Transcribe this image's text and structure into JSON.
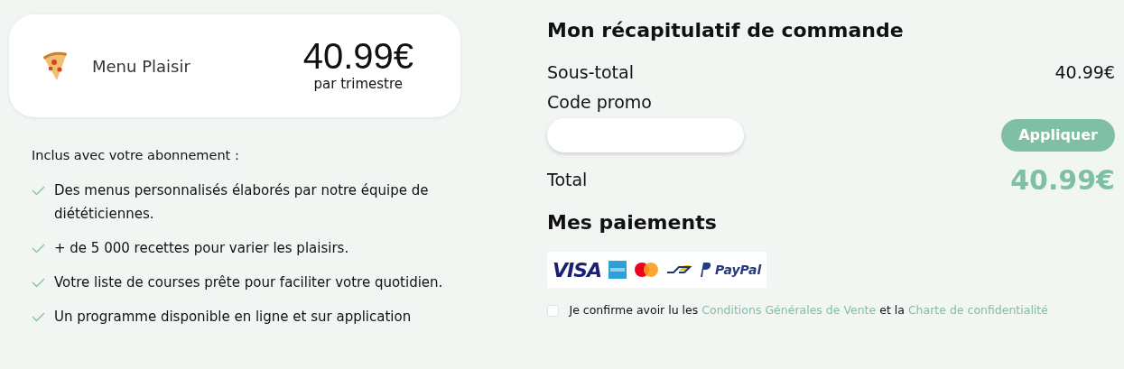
{
  "plan": {
    "name": "Menu Plaisir",
    "price": "40.99€",
    "period": "par trimestre"
  },
  "included": {
    "title": "Inclus avec votre abonnement :",
    "items": [
      {
        "text": "Des menus personnalisés élaborés par notre équipe de diététiciennes."
      },
      {
        "text": "+ de 5 000 recettes pour varier les plaisirs."
      },
      {
        "text": "Votre liste de courses prête pour faciliter votre quotidien."
      },
      {
        "text": "Un programme disponible en ligne et sur application"
      }
    ]
  },
  "summary": {
    "title": "Mon récapitulatif de commande",
    "subtotal_label": "Sous-total",
    "subtotal": "40.99€",
    "promo_label": "Code promo",
    "apply_button": "Appliquer",
    "total_label": "Total",
    "total": "40.99€"
  },
  "payments": {
    "title": "Mes paiements",
    "logos": [
      {
        "kind": "visa",
        "text": "VISA"
      },
      {
        "kind": "amex"
      },
      {
        "kind": "mastercard"
      },
      {
        "kind": "bancontact"
      },
      {
        "kind": "paypal",
        "text": "PayPal"
      }
    ]
  },
  "consent": {
    "checked": false,
    "parts": [
      {
        "kind": "text",
        "text": "Je confirme avoir lu les"
      },
      {
        "kind": "link",
        "text": "Conditions Générales de Vente"
      },
      {
        "kind": "text",
        "text": "et la"
      },
      {
        "kind": "link",
        "text": "Charte de confidentialité"
      }
    ]
  }
}
